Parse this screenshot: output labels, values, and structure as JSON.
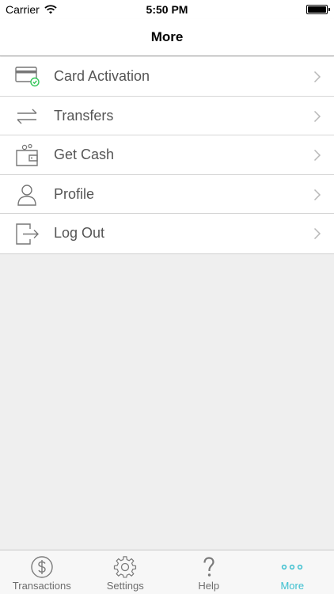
{
  "status_bar": {
    "carrier": "Carrier",
    "time": "5:50 PM",
    "battery_level": 1.0
  },
  "nav": {
    "title": "More"
  },
  "menu": {
    "items": [
      {
        "label": "Card Activation",
        "icon": "card-activation-icon"
      },
      {
        "label": "Transfers",
        "icon": "transfer-arrows-icon"
      },
      {
        "label": "Get Cash",
        "icon": "wallet-icon"
      },
      {
        "label": "Profile",
        "icon": "person-icon"
      },
      {
        "label": "Log Out",
        "icon": "logout-icon"
      }
    ]
  },
  "tab_bar": {
    "tabs": [
      {
        "label": "Transactions",
        "icon": "dollar-circle-icon",
        "active": false
      },
      {
        "label": "Settings",
        "icon": "gear-icon",
        "active": false
      },
      {
        "label": "Help",
        "icon": "question-mark-icon",
        "active": false
      },
      {
        "label": "More",
        "icon": "more-dots-icon",
        "active": true
      }
    ]
  },
  "colors": {
    "accent": "#3bbfcf",
    "success": "#34c759",
    "icon_gray": "#777777",
    "label_gray": "#555555"
  }
}
